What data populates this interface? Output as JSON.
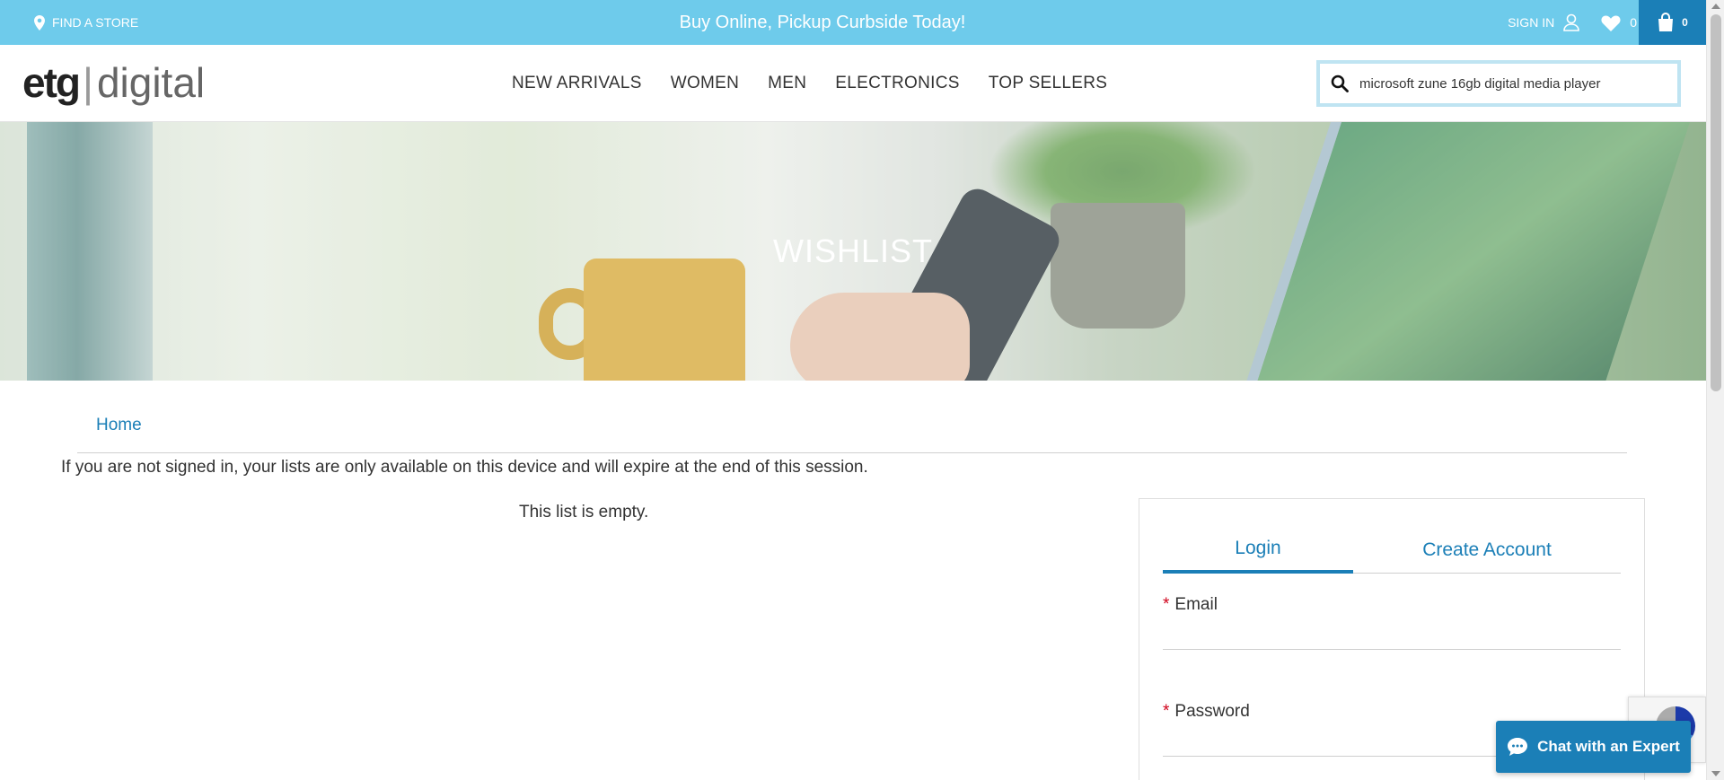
{
  "topbar": {
    "find_store": "FIND A STORE",
    "promo": "Buy Online, Pickup Curbside Today!",
    "sign_in": "SIGN IN",
    "wishlist_count": "0",
    "cart_count": "0",
    "background_color": "#6ecbeb",
    "cart_color": "#1b7fb7"
  },
  "header": {
    "logo_etg": "etg",
    "logo_sep": "|",
    "logo_digital": "digital",
    "nav": [
      "NEW ARRIVALS",
      "WOMEN",
      "MEN",
      "ELECTRONICS",
      "TOP SELLERS"
    ],
    "search_value": "microsoft zune 16gb digital media player"
  },
  "hero": {
    "title": "WISHLIST"
  },
  "main": {
    "breadcrumb_home": "Home",
    "notice": "If you are not signed in, your lists are only available on this device and will expire at the end of this session.",
    "empty_message": "This list is empty."
  },
  "login": {
    "tabs": [
      "Login",
      "Create Account"
    ],
    "required_mark": "*",
    "email_label": "Email",
    "password_label": "Password"
  },
  "chat": {
    "label": "Chat with an Expert"
  },
  "icons": {
    "location": "location-pin-icon",
    "user": "user-icon",
    "heart": "heart-icon",
    "cart": "shopping-bag-icon",
    "search": "search-icon",
    "chat": "chat-bubble-icon"
  },
  "accent_color": "#1b7fb7"
}
